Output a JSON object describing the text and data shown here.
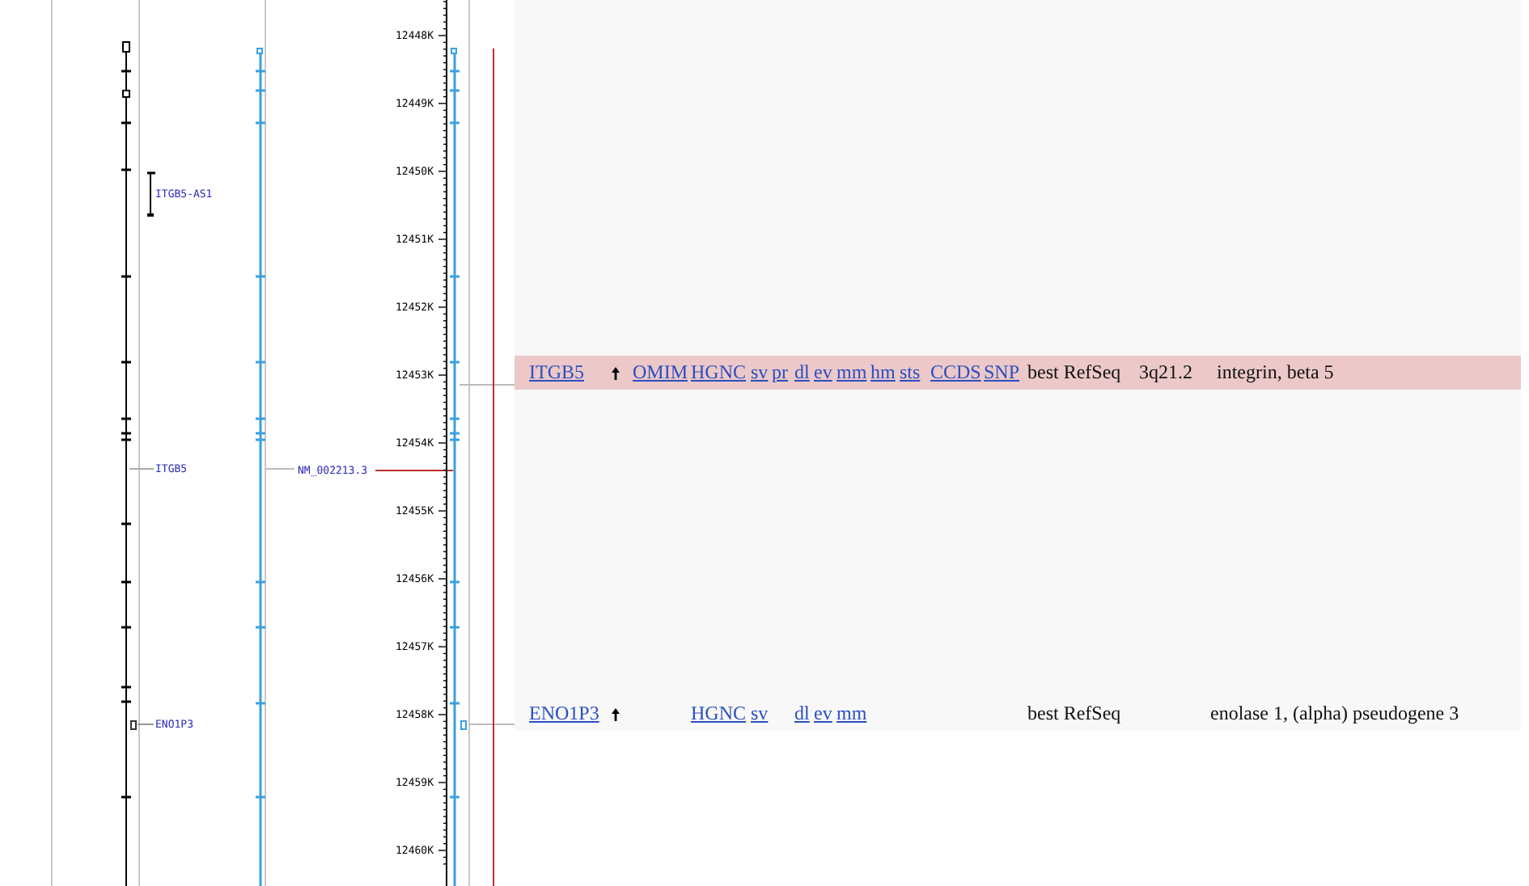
{
  "map": {
    "gene_labels": [
      "ITGB5-AS1",
      "ITGB5",
      "ENO1P3"
    ],
    "transcript_label": "NM_002213.3",
    "ruler": [
      "12448K",
      "12449K",
      "12450K",
      "12451K",
      "12452K",
      "12453K",
      "12454K",
      "12455K",
      "12456K",
      "12457K",
      "12458K",
      "12459K",
      "12460K"
    ]
  },
  "genes": [
    {
      "symbol": "ITGB5",
      "selected": true,
      "links": {
        "omim": "OMIM",
        "hgnc": "HGNC",
        "sv": "sv",
        "pr": "pr",
        "dl": "dl",
        "ev": "ev",
        "mm": "mm",
        "hm": "hm",
        "sts": "sts",
        "ccds": "CCDS",
        "snp": "SNP"
      },
      "evidence": "best RefSeq",
      "location": "3q21.2",
      "description": "integrin, beta 5"
    },
    {
      "symbol": "ENO1P3",
      "selected": false,
      "links": {
        "hgnc": "HGNC",
        "sv": "sv",
        "dl": "dl",
        "ev": "ev",
        "mm": "mm"
      },
      "evidence": "best RefSeq",
      "description": "enolase 1, (alpha) pseudogene 3"
    }
  ]
}
